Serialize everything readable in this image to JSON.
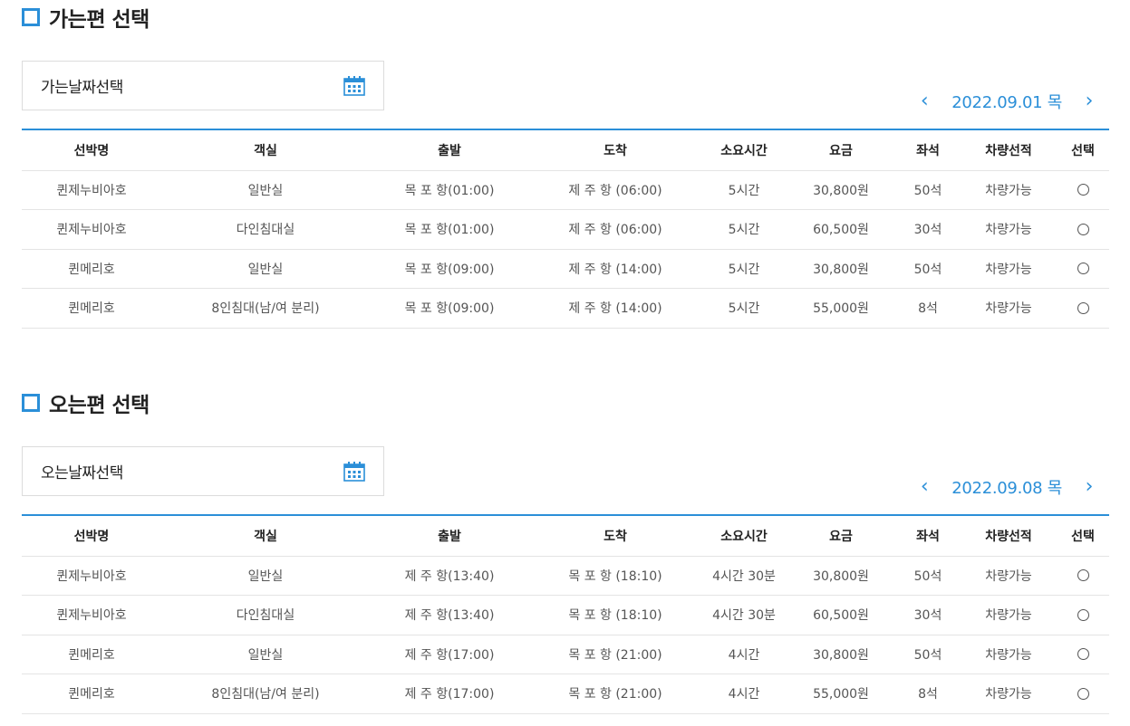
{
  "colors": {
    "accent": "#2b8fd8",
    "border": "#dcdcdc"
  },
  "icons": {
    "date": "calendar-icon",
    "prev": "chevron-left-icon",
    "next": "chevron-right-icon"
  },
  "outbound": {
    "title": "가는편 선택",
    "date_label": "가는날짜선택",
    "date": "2022.09.01 목",
    "prev": "‹",
    "next": "›",
    "headers": [
      "선박명",
      "객실",
      "출발",
      "도착",
      "소요시간",
      "요금",
      "좌석",
      "차량선적",
      "선택"
    ],
    "rows": [
      [
        "퀸제누비아호",
        "일반실",
        "목 포 항(01:00)",
        "제 주 항 (06:00)",
        "5시간",
        "30,800원",
        "50석",
        "차량가능"
      ],
      [
        "퀸제누비아호",
        "다인침대실",
        "목 포 항(01:00)",
        "제 주 항 (06:00)",
        "5시간",
        "60,500원",
        "30석",
        "차량가능"
      ],
      [
        "퀸메리호",
        "일반실",
        "목 포 항(09:00)",
        "제 주 항 (14:00)",
        "5시간",
        "30,800원",
        "50석",
        "차량가능"
      ],
      [
        "퀸메리호",
        "8인침대(남/여 분리)",
        "목 포 항(09:00)",
        "제 주 항 (14:00)",
        "5시간",
        "55,000원",
        "8석",
        "차량가능"
      ]
    ]
  },
  "return": {
    "title": "오는편 선택",
    "date_label": "오는날짜선택",
    "date": "2022.09.08 목",
    "prev": "‹",
    "next": "›",
    "headers": [
      "선박명",
      "객실",
      "출발",
      "도착",
      "소요시간",
      "요금",
      "좌석",
      "차량선적",
      "선택"
    ],
    "rows": [
      [
        "퀸제누비아호",
        "일반실",
        "제 주 항(13:40)",
        "목 포 항 (18:10)",
        "4시간 30분",
        "30,800원",
        "50석",
        "차량가능"
      ],
      [
        "퀸제누비아호",
        "다인침대실",
        "제 주 항(13:40)",
        "목 포 항 (18:10)",
        "4시간 30분",
        "60,500원",
        "30석",
        "차량가능"
      ],
      [
        "퀸메리호",
        "일반실",
        "제 주 항(17:00)",
        "목 포 항 (21:00)",
        "4시간",
        "30,800원",
        "50석",
        "차량가능"
      ],
      [
        "퀸메리호",
        "8인침대(남/여 분리)",
        "제 주 항(17:00)",
        "목 포 항 (21:00)",
        "4시간",
        "55,000원",
        "8석",
        "차량가능"
      ]
    ]
  }
}
